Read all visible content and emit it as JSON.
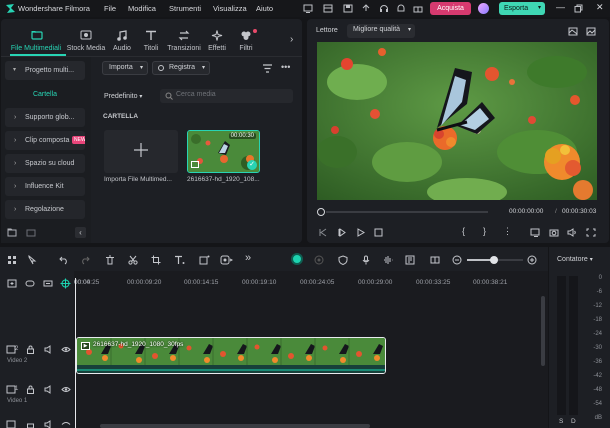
{
  "app": {
    "title": "Wondershare Filmora"
  },
  "menu": [
    "File",
    "Modifica",
    "Strumenti",
    "Visualizza",
    "Aiuto"
  ],
  "titlebar": {
    "buy_label": "Acquista",
    "export_label": "Esporta"
  },
  "media_tabs": [
    "File Multimediali",
    "Stock Media",
    "Audio",
    "Titoli",
    "Transizioni",
    "Effetti",
    "Filtri"
  ],
  "sidebar": {
    "project_label": "Progetto multi...",
    "items": [
      {
        "label": "Cartella"
      },
      {
        "label": "Supporto glob..."
      },
      {
        "label": "Clip composta",
        "badge": "NEW"
      },
      {
        "label": "Spazio su cloud"
      },
      {
        "label": "Influence Kit"
      },
      {
        "label": "Regolazione"
      }
    ]
  },
  "media_toolbar": {
    "import_label": "Importa",
    "record_label": "Registra",
    "sort_label": "Predefinito",
    "search_placeholder": "Cerca media"
  },
  "media_section": {
    "title": "CARTELLA"
  },
  "media_items": [
    {
      "label": "Importa File Multimed..."
    },
    {
      "label": "2616637-hd_1920_108...",
      "duration": "00:00:30"
    }
  ],
  "player": {
    "label": "Lettore",
    "quality": "Migliore qualità",
    "current_time": "00:00:00:00",
    "total_time": "00:00:30:03",
    "progress": 0
  },
  "timeline": {
    "ruler": [
      "00:00",
      "00:04:25",
      "00:00:09:20",
      "00:00:14:15",
      "00:00:19:10",
      "00:00:24:05",
      "00:00:29:00",
      "00:00:33:25",
      "00:00:38:21"
    ],
    "tracks": [
      {
        "label": "Video 2",
        "number": "2"
      },
      {
        "label": "Video 1",
        "number": "1"
      }
    ],
    "clip_label": "2616637-hd_1920_1080_30fps",
    "meter_label": "Contatore",
    "db_scale": [
      "0",
      "-6",
      "-12",
      "-18",
      "-24",
      "-30",
      "-36",
      "-42",
      "-48",
      "-54"
    ],
    "db_unit": "dB",
    "channels": [
      "S",
      "D"
    ]
  },
  "colors": {
    "accent": "#1dd3b0",
    "buy": "#d63a6f",
    "export": "#3fd7b4"
  }
}
